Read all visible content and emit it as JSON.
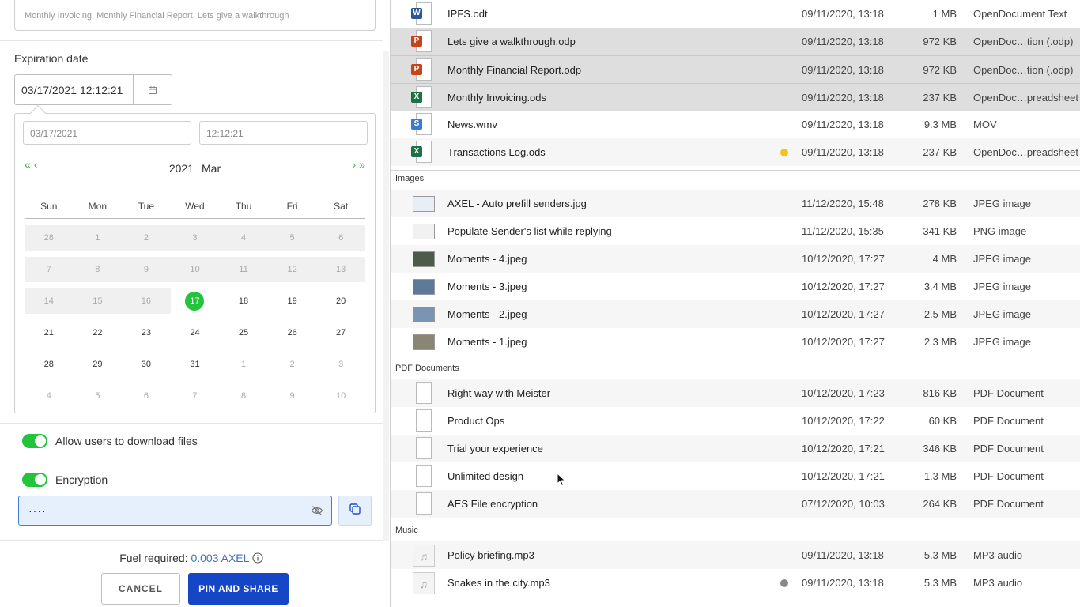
{
  "share_panel": {
    "tags_text": "Monthly Invoicing, Monthly Financial Report, Lets give a walkthrough",
    "expiration_label": "Expiration date",
    "expiration_value": "03/17/2021 12:12:21",
    "picker": {
      "date_value": "03/17/2021",
      "time_value": "12:12:21",
      "year": "2021",
      "month": "Mar",
      "weekdays": [
        "Sun",
        "Mon",
        "Tue",
        "Wed",
        "Thu",
        "Fri",
        "Sat"
      ],
      "weeks": [
        [
          {
            "d": "28",
            "s": "dis"
          },
          {
            "d": "1",
            "s": "dis"
          },
          {
            "d": "2",
            "s": "dis"
          },
          {
            "d": "3",
            "s": "dis"
          },
          {
            "d": "4",
            "s": "dis"
          },
          {
            "d": "5",
            "s": "dis"
          },
          {
            "d": "6",
            "s": "dis"
          }
        ],
        [
          {
            "d": "7",
            "s": "dis"
          },
          {
            "d": "8",
            "s": "dis"
          },
          {
            "d": "9",
            "s": "dis"
          },
          {
            "d": "10",
            "s": "dis"
          },
          {
            "d": "11",
            "s": "dis"
          },
          {
            "d": "12",
            "s": "dis"
          },
          {
            "d": "13",
            "s": "dis"
          }
        ],
        [
          {
            "d": "14",
            "s": "dis"
          },
          {
            "d": "15",
            "s": "dis"
          },
          {
            "d": "16",
            "s": "dis"
          },
          {
            "d": "17",
            "s": "sel"
          },
          {
            "d": "18",
            "s": ""
          },
          {
            "d": "19",
            "s": ""
          },
          {
            "d": "20",
            "s": ""
          }
        ],
        [
          {
            "d": "21",
            "s": ""
          },
          {
            "d": "22",
            "s": ""
          },
          {
            "d": "23",
            "s": ""
          },
          {
            "d": "24",
            "s": ""
          },
          {
            "d": "25",
            "s": ""
          },
          {
            "d": "26",
            "s": ""
          },
          {
            "d": "27",
            "s": ""
          }
        ],
        [
          {
            "d": "28",
            "s": ""
          },
          {
            "d": "29",
            "s": ""
          },
          {
            "d": "30",
            "s": ""
          },
          {
            "d": "31",
            "s": ""
          },
          {
            "d": "1",
            "s": "out"
          },
          {
            "d": "2",
            "s": "out"
          },
          {
            "d": "3",
            "s": "out"
          }
        ],
        [
          {
            "d": "4",
            "s": "out"
          },
          {
            "d": "5",
            "s": "out"
          },
          {
            "d": "6",
            "s": "out"
          },
          {
            "d": "7",
            "s": "out"
          },
          {
            "d": "8",
            "s": "out"
          },
          {
            "d": "9",
            "s": "out"
          },
          {
            "d": "10",
            "s": "out"
          }
        ]
      ]
    },
    "allow_download_label": "Allow users to download files",
    "encryption_label": "Encryption",
    "password_value": "····",
    "fuel_label": "Fuel required:",
    "fuel_amount": "0.003 AXEL",
    "cancel_label": "CANCEL",
    "pin_label": "PIN AND SHARE",
    "accent_color": "#22c43a",
    "primary_color": "#1546c5"
  },
  "files": {
    "top": [
      {
        "name": "IPFS.odt",
        "date": "09/11/2020, 13:18",
        "size": "1 MB",
        "type": "OpenDocument Text",
        "icon": "word-icon",
        "state": ""
      },
      {
        "name": "Lets give a walkthrough.odp",
        "date": "09/11/2020, 13:18",
        "size": "972 KB",
        "type": "OpenDoc…tion (.odp)",
        "icon": "powerpoint-icon",
        "state": "sel"
      },
      {
        "name": "Monthly Financial Report.odp",
        "date": "09/11/2020, 13:18",
        "size": "972 KB",
        "type": "OpenDoc…tion (.odp)",
        "icon": "powerpoint-icon",
        "state": "sel"
      },
      {
        "name": "Monthly Invoicing.ods",
        "date": "09/11/2020, 13:18",
        "size": "237 KB",
        "type": "OpenDoc…preadsheet",
        "icon": "excel-icon",
        "state": "sel"
      },
      {
        "name": "News.wmv",
        "date": "09/11/2020, 13:18",
        "size": "9.3 MB",
        "type": "MOV",
        "icon": "video-icon",
        "state": ""
      },
      {
        "name": "Transactions Log.ods",
        "date": "09/11/2020, 13:18",
        "size": "237 KB",
        "type": "OpenDoc…preadsheet",
        "icon": "excel-icon",
        "state": "alt",
        "dot": "#f2c31a"
      }
    ],
    "images_header": "Images",
    "images": [
      {
        "name": "AXEL - Auto prefill senders.jpg",
        "date": "11/12/2020, 15:48",
        "size": "278 KB",
        "type": "JPEG image",
        "state": "alt",
        "thumb": "#e8eef5"
      },
      {
        "name": "Populate Sender's list while replying",
        "date": "11/12/2020, 15:35",
        "size": "341 KB",
        "type": "PNG image",
        "state": "",
        "thumb": "#f1f1f1"
      },
      {
        "name": "Moments - 4.jpeg",
        "date": "10/12/2020, 17:27",
        "size": "4 MB",
        "type": "JPEG image",
        "state": "alt",
        "thumb": "#4b5d4a"
      },
      {
        "name": "Moments - 3.jpeg",
        "date": "10/12/2020, 17:27",
        "size": "3.4 MB",
        "type": "JPEG image",
        "state": "",
        "thumb": "#5e7a9a"
      },
      {
        "name": "Moments - 2.jpeg",
        "date": "10/12/2020, 17:27",
        "size": "2.5 MB",
        "type": "JPEG image",
        "state": "alt",
        "thumb": "#7a94b2"
      },
      {
        "name": "Moments - 1.jpeg",
        "date": "10/12/2020, 17:27",
        "size": "2.3 MB",
        "type": "JPEG image",
        "state": "",
        "thumb": "#8a8676"
      }
    ],
    "pdf_header": "PDF Documents",
    "pdfs": [
      {
        "name": "Right way with Meister",
        "date": "10/12/2020, 17:23",
        "size": "816 KB",
        "type": "PDF Document",
        "state": "alt"
      },
      {
        "name": "Product Ops",
        "date": "10/12/2020, 17:22",
        "size": "60 KB",
        "type": "PDF Document",
        "state": ""
      },
      {
        "name": "Trial your experience",
        "date": "10/12/2020, 17:21",
        "size": "346 KB",
        "type": "PDF Document",
        "state": "alt"
      },
      {
        "name": "Unlimited design",
        "date": "10/12/2020, 17:21",
        "size": "1.3 MB",
        "type": "PDF Document",
        "state": ""
      },
      {
        "name": "AES File encryption",
        "date": "07/12/2020, 10:03",
        "size": "264 KB",
        "type": "PDF Document",
        "state": "alt"
      }
    ],
    "music_header": "Music",
    "music": [
      {
        "name": "Policy briefing.mp3",
        "date": "09/11/2020, 13:18",
        "size": "5.3 MB",
        "type": "MP3 audio",
        "state": "alt"
      },
      {
        "name": "Snakes in the city.mp3",
        "date": "09/11/2020, 13:18",
        "size": "5.3 MB",
        "type": "MP3 audio",
        "state": "",
        "dot": "#888888"
      }
    ]
  }
}
